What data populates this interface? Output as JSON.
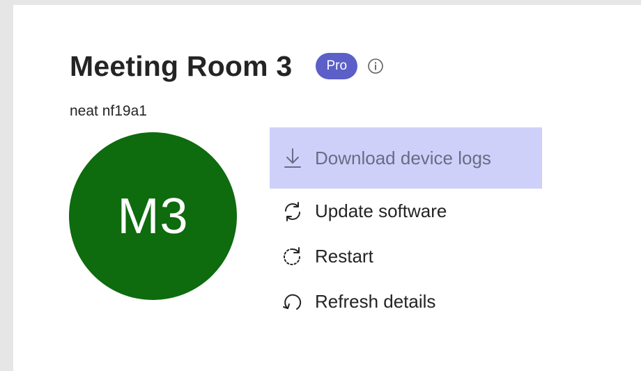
{
  "device": {
    "title": "Meeting Room 3",
    "badge": "Pro",
    "model": "neat nf19a1",
    "avatar_initials": "M3",
    "avatar_color": "#0e6b0e"
  },
  "actions": [
    {
      "label": "Download device logs",
      "icon": "download-icon",
      "highlighted": true
    },
    {
      "label": "Update software",
      "icon": "sync-icon"
    },
    {
      "label": "Restart",
      "icon": "restart-icon"
    },
    {
      "label": "Refresh details",
      "icon": "refresh-icon"
    }
  ],
  "colors": {
    "accent": "#5b5fc7",
    "hover_bg": "#cfd0fa"
  }
}
